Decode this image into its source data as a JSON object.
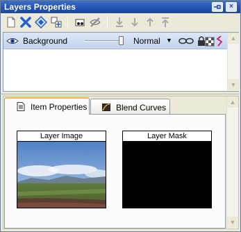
{
  "window": {
    "title": "Layers Properties",
    "title_color": "#ffffff",
    "titlebar_color": "#2553b4",
    "buttons": [
      {
        "name": "pin",
        "icon": "pin-icon"
      },
      {
        "name": "close",
        "icon": "close-icon",
        "glyph": "×"
      }
    ]
  },
  "toolbar": {
    "items": [
      {
        "icon": "new-layer-icon",
        "enabled": true
      },
      {
        "icon": "delete-layer-icon",
        "enabled": true
      },
      {
        "icon": "duplicate-layer-icon",
        "enabled": true
      },
      {
        "icon": "layer-properties-icon",
        "enabled": true
      },
      {
        "icon": "show-all-icon",
        "enabled": true
      },
      {
        "icon": "hide-all-icon",
        "enabled": true
      },
      {
        "icon": "merge-down-icon",
        "enabled": false
      },
      {
        "icon": "move-down-icon",
        "enabled": false
      },
      {
        "icon": "move-up-icon",
        "enabled": false
      },
      {
        "icon": "move-to-top-icon",
        "enabled": false
      }
    ]
  },
  "layers": [
    {
      "name": "Background",
      "visible": true,
      "selected": true,
      "opacity": 1.0,
      "blend_mode": "Normal",
      "blend_dropdown_glyph": "▼",
      "icons": [
        "eye-icon",
        "mask-link-icon",
        "lock-icon",
        "transparency-icon",
        "layer-style-icon"
      ]
    }
  ],
  "lower_panel": {
    "tabs": [
      {
        "label": "Item Properties",
        "icon": "document-icon",
        "active": true
      },
      {
        "label": "Blend Curves",
        "icon": "blend-curves-icon",
        "active": false
      }
    ],
    "thumbnails": {
      "image_title": "Layer Image",
      "mask_title": "Layer Mask"
    }
  },
  "scroll": {
    "up_glyph": "▲",
    "down_glyph": "▼"
  },
  "colors": {
    "selection": "#c3d3ee",
    "active_tab_accent": "#f1b541",
    "panel_bg": "#ece9d8"
  }
}
